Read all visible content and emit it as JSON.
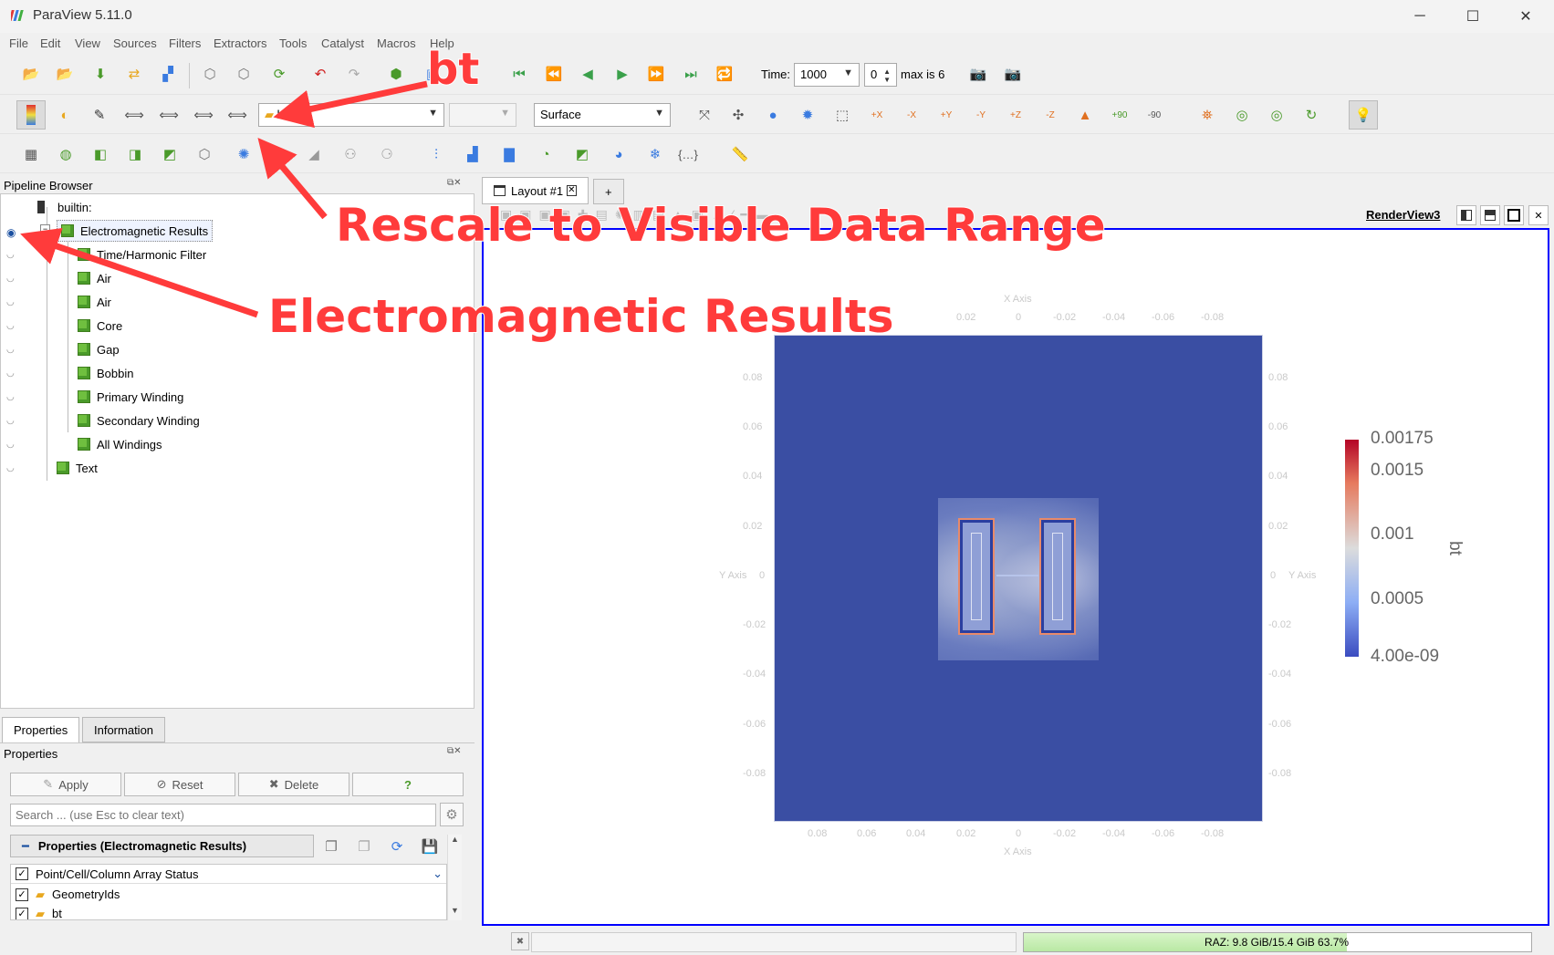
{
  "window": {
    "title": "ParaView 5.11.0",
    "minimize": "─",
    "maximize": "☐",
    "close": "✕"
  },
  "menu": [
    "File",
    "Edit",
    "View",
    "Sources",
    "Filters",
    "Extractors",
    "Tools",
    "Catalyst",
    "Macros",
    "Help"
  ],
  "time": {
    "label": "Time:",
    "value": "1000",
    "index": "0",
    "max": "max is 6"
  },
  "toolbar2": {
    "array": "bt",
    "component": "",
    "representation": "Surface"
  },
  "camera_labels": [
    "+X",
    "-X",
    "+Y",
    "-Y",
    "+Z",
    "-Z",
    "+90",
    "-90"
  ],
  "pipeline": {
    "title": "Pipeline Browser",
    "root": "builtin:",
    "items": [
      "Electromagnetic Results",
      "Time/Harmonic Filter",
      "Air",
      "Air",
      "Core",
      "Gap",
      "Bobbin",
      "Primary Winding",
      "Secondary Winding",
      "All Windings",
      "Text"
    ]
  },
  "tabs": {
    "properties": "Properties",
    "information": "Information"
  },
  "properties": {
    "title": "Properties",
    "apply": "Apply",
    "reset": "Reset",
    "delete": "Delete",
    "help": "?",
    "search_placeholder": "Search ... (use Esc to clear text)",
    "section": "Properties (Electromagnetic Results)",
    "array_status": "Point/Cell/Column Array Status",
    "arrays": [
      "GeometryIds",
      "bt"
    ]
  },
  "layout": {
    "tab": "Layout #1",
    "add": "+",
    "view_name": "RenderView3"
  },
  "axes": {
    "x_title": "X Axis",
    "y_title": "Y Axis",
    "top_ticks": [
      "0.02",
      "0",
      "-0.02",
      "-0.04",
      "-0.06",
      "-0.08"
    ],
    "bottom_ticks": [
      "0.08",
      "0.06",
      "0.04",
      "0.02",
      "0",
      "-0.02",
      "-0.04",
      "-0.06",
      "-0.08"
    ],
    "y_ticks": [
      "0.08",
      "0.06",
      "0.04",
      "0.02",
      "0",
      "-0.02",
      "-0.04",
      "-0.06",
      "-0.08"
    ]
  },
  "colorbar": {
    "title": "bt",
    "labels": [
      "0.00175",
      "0.0015",
      "0.001",
      "0.0005",
      "4.00e-09"
    ]
  },
  "annotations": {
    "bt": "bt",
    "rescale": "Rescale to Visible Data Range",
    "em": "Electromagnetic Results"
  },
  "status": {
    "memory": "RAZ: 9.8 GiB/15.4 GiB 63.7%",
    "memory_fraction": 0.637
  },
  "colors": {
    "accent": "#0000ff",
    "field_low": "#3a4ea3",
    "annotation": "#ff3b3b"
  }
}
